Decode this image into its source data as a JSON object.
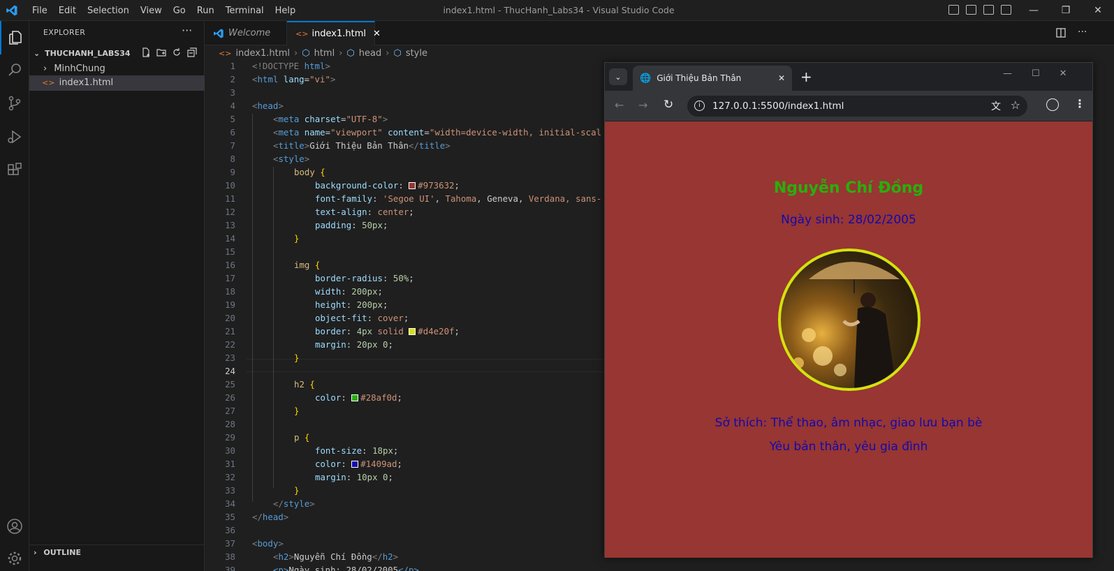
{
  "titlebar": {
    "menu": [
      "File",
      "Edit",
      "Selection",
      "View",
      "Go",
      "Run",
      "Terminal",
      "Help"
    ],
    "window_title": "index1.html - ThucHanh_Labs34 - Visual Studio Code"
  },
  "sidebar": {
    "header": "EXPLORER",
    "more": "···",
    "folder": "THUCHANH_LABS34",
    "items": [
      {
        "label": "MinhChung",
        "type": "folder"
      },
      {
        "label": "index1.html",
        "type": "file"
      }
    ],
    "outline": "OUTLINE"
  },
  "tabs": [
    {
      "label": "Welcome",
      "active": false
    },
    {
      "label": "index1.html",
      "active": true
    }
  ],
  "breadcrumb": [
    "index1.html",
    "html",
    "head",
    "style"
  ],
  "code": {
    "current_line": 24,
    "line_numbers": [
      "1",
      "2",
      "3",
      "4",
      "5",
      "6",
      "7",
      "8",
      "9",
      "10",
      "11",
      "12",
      "13",
      "14",
      "15",
      "16",
      "17",
      "18",
      "19",
      "20",
      "21",
      "22",
      "23",
      "24",
      "25",
      "26",
      "27",
      "28",
      "29",
      "30",
      "31",
      "32",
      "33",
      "34",
      "35",
      "36",
      "37",
      "38",
      "39"
    ]
  },
  "code_text": {
    "l1a": "<!DOCTYPE ",
    "l1b": "html",
    "l1c": ">",
    "l2a": "<",
    "l2b": "html",
    "l2c": " lang",
    "l2d": "=",
    "l2e": "\"vi\"",
    "l2f": ">",
    "l4a": "<",
    "l4b": "head",
    "l4c": ">",
    "l5a": "<",
    "l5b": "meta",
    "l5c": " charset",
    "l5d": "=",
    "l5e": "\"UTF-8\"",
    "l5f": ">",
    "l6a": "<",
    "l6b": "meta",
    "l6c": " name",
    "l6d": "=",
    "l6e": "\"viewport\"",
    "l6f": " content",
    "l6g": "=",
    "l6h": "\"width=device-width, initial-scal",
    "l7a": "<",
    "l7b": "title",
    "l7c": ">",
    "l7d": "Giới Thiệu Bản Thân",
    "l7e": "</",
    "l7f": "title",
    "l7g": ">",
    "l8a": "<",
    "l8b": "style",
    "l8c": ">",
    "l9a": "body",
    "l9b": " {",
    "l10a": "background-color",
    "l10b": ": ",
    "l10c": "#973632",
    "l10d": ";",
    "l11a": "font-family",
    "l11b": ": ",
    "l11c": "'Segoe UI'",
    "l11d": ", ",
    "l11e": "Tahoma",
    "l11f": ", Geneva, ",
    "l11g": "Verdana",
    "l11h": ", sans-",
    "l12a": "text-align",
    "l12b": ": ",
    "l12c": "center",
    "l12d": ";",
    "l13a": "padding",
    "l13b": ": ",
    "l13c": "50px",
    "l13d": ";",
    "l14": "}",
    "l16a": "img",
    "l16b": " {",
    "l17a": "border-radius",
    "l17b": ": ",
    "l17c": "50%",
    "l17d": ";",
    "l18a": "width",
    "l18b": ": ",
    "l18c": "200px",
    "l18d": ";",
    "l19a": "height",
    "l19b": ": ",
    "l19c": "200px",
    "l19d": ";",
    "l20a": "object-fit",
    "l20b": ": ",
    "l20c": "cover",
    "l20d": ";",
    "l21a": "border",
    "l21b": ": ",
    "l21c": "4px",
    "l21d": " solid ",
    "l21e": "#d4e20f",
    "l21f": ";",
    "l22a": "margin",
    "l22b": ": ",
    "l22c": "20px 0",
    "l22d": ";",
    "l23": "}",
    "l25a": "h2",
    "l25b": " {",
    "l26a": "color",
    "l26b": ": ",
    "l26c": "#28af0d",
    "l26d": ";",
    "l27": "}",
    "l29a": "p",
    "l29b": " {",
    "l30a": "font-size",
    "l30b": ": ",
    "l30c": "18px",
    "l30d": ";",
    "l31a": "color",
    "l31b": ": ",
    "l31c": "#1409ad",
    "l31d": ";",
    "l32a": "margin",
    "l32b": ": ",
    "l32c": "10px 0",
    "l32d": ";",
    "l33": "}",
    "l34a": "</",
    "l34b": "style",
    "l34c": ">",
    "l35a": "</",
    "l35b": "head",
    "l35c": ">",
    "l37a": "<",
    "l37b": "body",
    "l37c": ">",
    "l38a": "<",
    "l38b": "h2",
    "l38c": ">",
    "l38d": "Nguyễn Chí Đồng",
    "l38e": "</",
    "l38f": "h2",
    "l38g": ">",
    "l39a": "<p>",
    "l39b": "Ngày sinh: 28/02/2005",
    "l39c": "</p>"
  },
  "colors": {
    "bg_swatch": "#973632",
    "border_swatch": "#d4e20f",
    "h2_swatch": "#28af0d",
    "p_swatch": "#1409ad"
  },
  "browser": {
    "tab_title": "Giới Thiệu Bản Thân",
    "url": "127.0.0.1:5500/index1.html",
    "page": {
      "name": "Nguyễn Chí Đồng",
      "birth": "Ngày sinh: 28/02/2005",
      "hobby": "Sở thích: Thể thao, âm nhạc, giao lưu bạn bè",
      "love": "Yêu bản thân, yêu gia đình"
    }
  }
}
